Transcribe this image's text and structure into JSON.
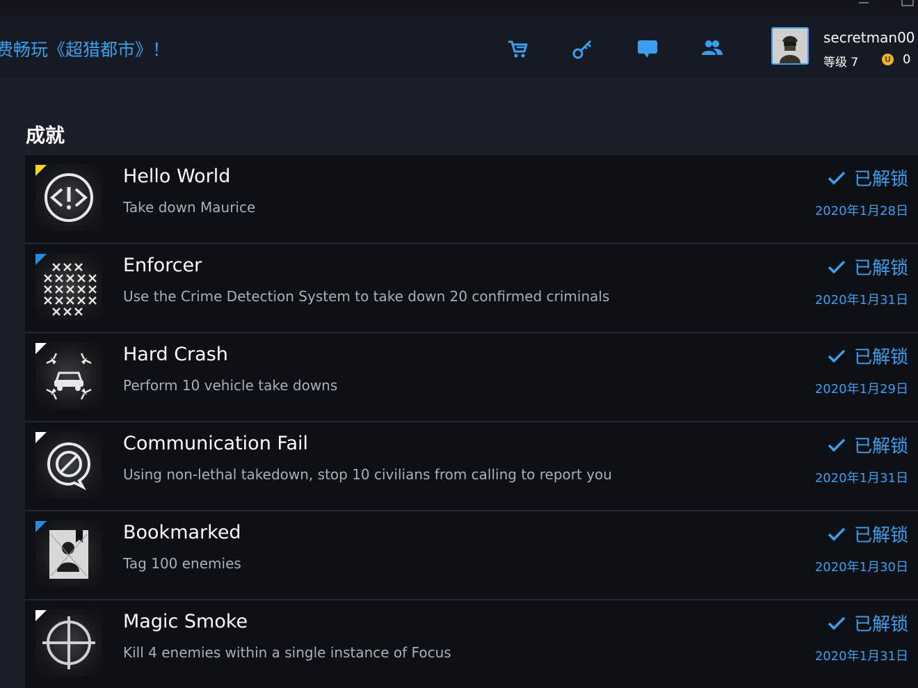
{
  "header": {
    "promo": "费畅玩《超猎都市》！",
    "user": {
      "name": "secretman00",
      "level_label": "等级 7",
      "coin_icon_letter": "U",
      "coins": "0"
    },
    "nav_icons": [
      "cart-icon",
      "key-icon",
      "chat-icon",
      "friends-icon"
    ]
  },
  "section": {
    "title": "成就"
  },
  "achievements": [
    {
      "title": "Hello World",
      "desc": "Take down Maurice",
      "status": "已解锁",
      "date": "2020年1月28日",
      "corner": "#f5d90a",
      "icon": "hello-world-badge-icon"
    },
    {
      "title": "Enforcer",
      "desc": "Use the Crime Detection System to take down 20 confirmed criminals",
      "status": "已解锁",
      "date": "2020年1月31日",
      "corner": "#1f8fe6",
      "icon": "enforcer-badge-icon"
    },
    {
      "title": "Hard Crash",
      "desc": "Perform 10 vehicle take downs",
      "status": "已解锁",
      "date": "2020年1月29日",
      "corner": "#ffffff",
      "icon": "hard-crash-badge-icon"
    },
    {
      "title": "Communication Fail",
      "desc": "Using non-lethal takedown, stop 10 civilians from calling to report you",
      "status": "已解锁",
      "date": "2020年1月31日",
      "corner": "#ffffff",
      "icon": "communication-fail-badge-icon"
    },
    {
      "title": "Bookmarked",
      "desc": "Tag 100 enemies",
      "status": "已解锁",
      "date": "2020年1月30日",
      "corner": "#1f8fe6",
      "icon": "bookmarked-badge-icon"
    },
    {
      "title": "Magic Smoke",
      "desc": "Kill 4 enemies within a single instance of Focus",
      "status": "已解锁",
      "date": "2020年1月31日",
      "corner": "#ffffff",
      "icon": "magic-smoke-badge-icon"
    }
  ],
  "colors": {
    "accent": "#3a9ff0",
    "background": "#1b1f27",
    "row_bg": "#0d1015"
  }
}
